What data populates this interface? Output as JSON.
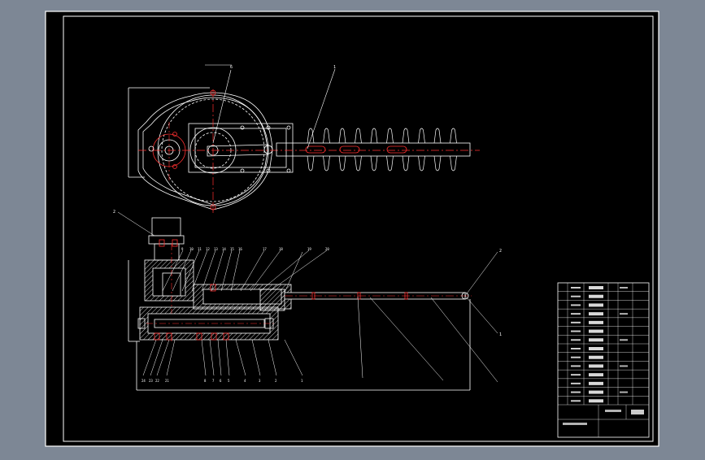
{
  "drawing": {
    "labels": {
      "top_view_note": "",
      "callouts_top": [
        "6",
        "1"
      ],
      "callouts_front_top": [
        "9",
        "10",
        "11",
        "12",
        "13",
        "14",
        "15",
        "16",
        "17",
        "18",
        "19",
        "20"
      ],
      "callouts_front_bottom": [
        "24",
        "23",
        "22",
        "21",
        "8",
        "7",
        "6",
        "5",
        "4",
        "3",
        "2",
        "1"
      ],
      "callout_right": [
        "2",
        "1"
      ],
      "motor_label": "2"
    },
    "title_block": {
      "rows": 14,
      "cols": 7
    }
  },
  "colors": {
    "background": "#7d8795",
    "sheet": "#000000",
    "line": "#ffffff",
    "hidden": "#c8c8c8",
    "red": "#ff3030",
    "hatch": "#ffffff"
  }
}
